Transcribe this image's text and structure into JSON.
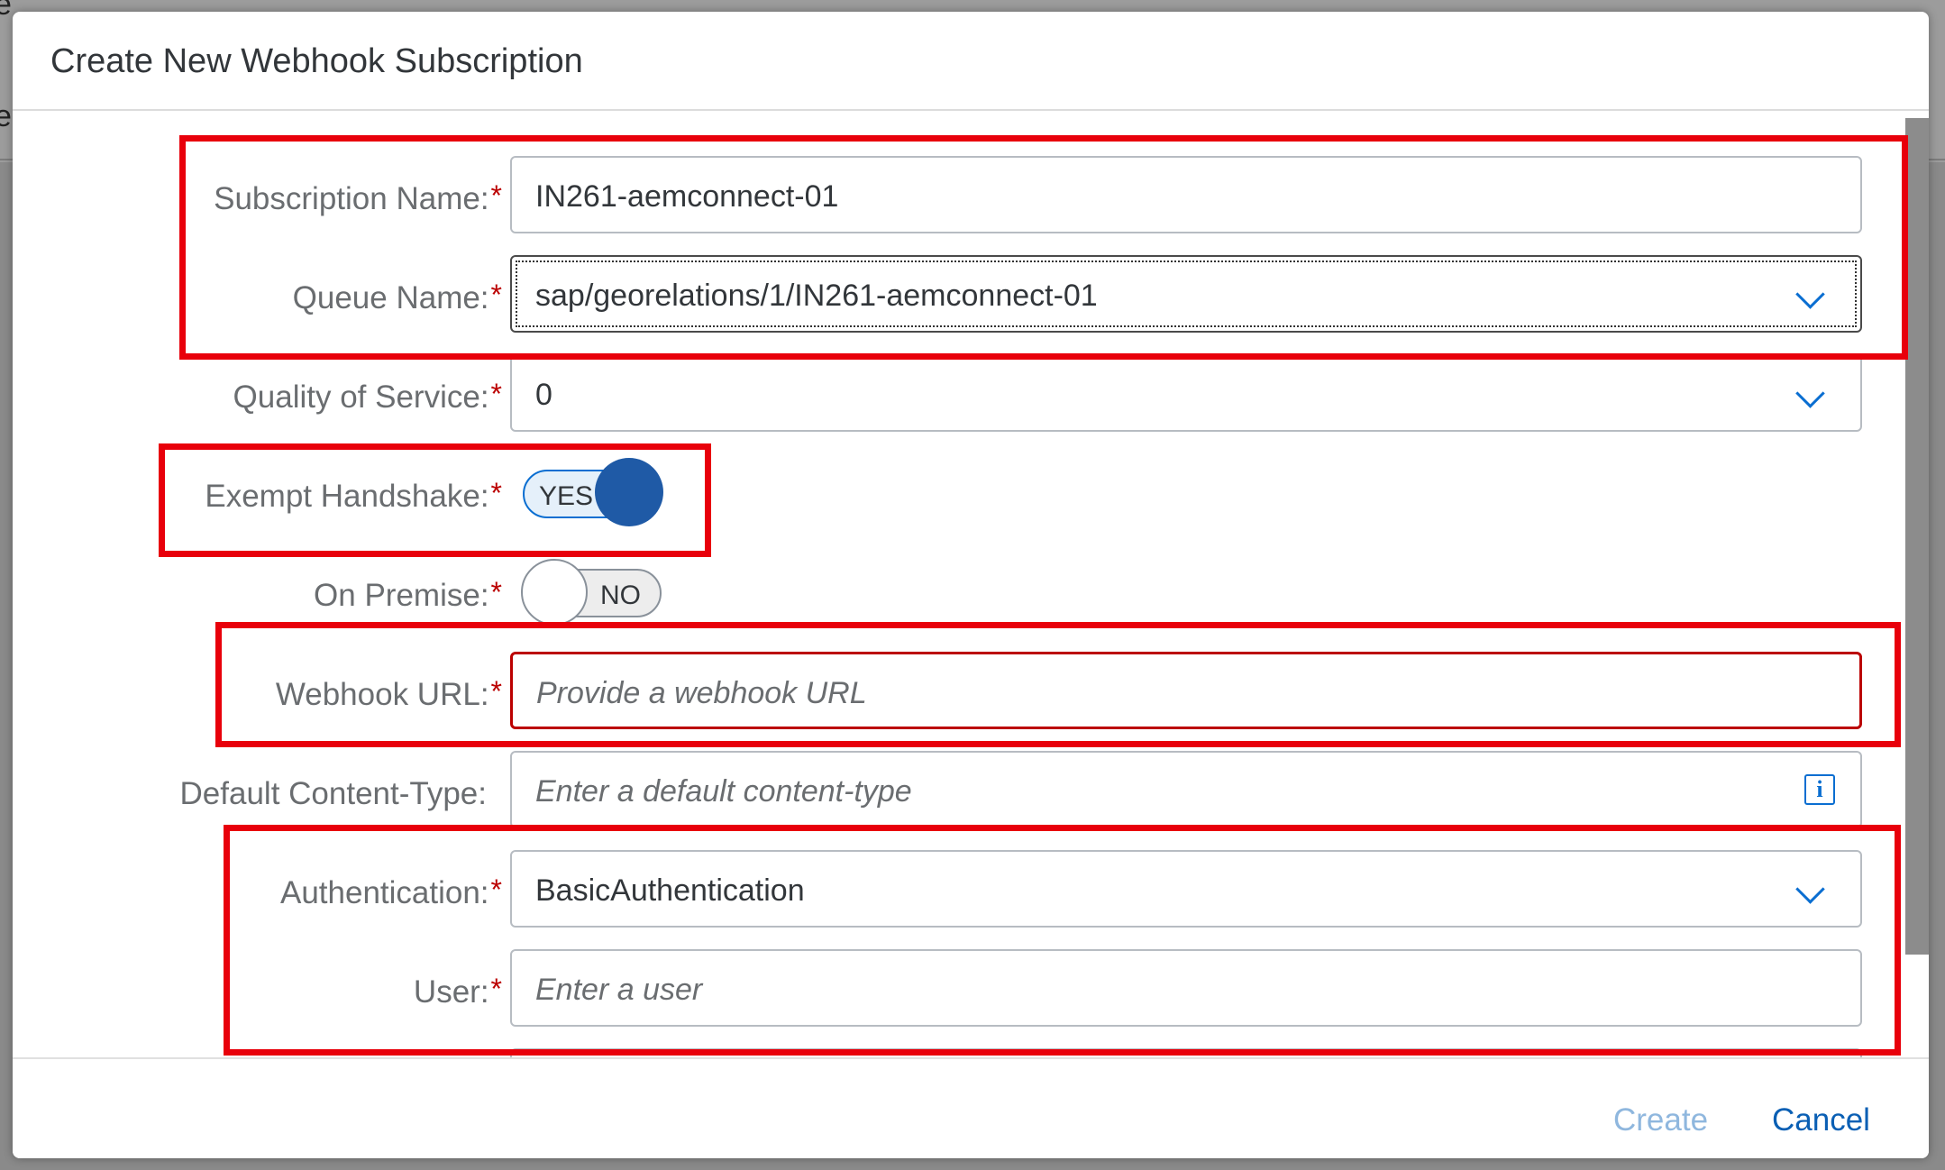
{
  "background": {
    "text_top": "e",
    "text_mid": "e"
  },
  "dialog": {
    "title": "Create New Webhook Subscription"
  },
  "form": {
    "subscription_name": {
      "label": "Subscription Name:",
      "required": "*",
      "value": "IN261-aemconnect-01"
    },
    "queue_name": {
      "label": "Queue Name:",
      "required": "*",
      "value": "sap/georelations/1/IN261-aemconnect-01"
    },
    "quality_of_service": {
      "label": "Quality of Service:",
      "required": "*",
      "value": "0"
    },
    "exempt_handshake": {
      "label": "Exempt Handshake:",
      "required": "*",
      "state": "YES"
    },
    "on_premise": {
      "label": "On Premise:",
      "required": "*",
      "state": "NO"
    },
    "webhook_url": {
      "label": "Webhook URL:",
      "required": "*",
      "placeholder": "Provide a webhook URL"
    },
    "default_content_type": {
      "label": "Default Content-Type:",
      "placeholder": "Enter a default content-type",
      "icon": "info-icon"
    },
    "authentication": {
      "label": "Authentication:",
      "required": "*",
      "value": "BasicAuthentication"
    },
    "user": {
      "label": "User:",
      "required": "*",
      "placeholder": "Enter a user"
    }
  },
  "footer": {
    "create_label": "Create",
    "cancel_label": "Cancel"
  },
  "colors": {
    "annotation": "#e8000b",
    "accent": "#0a6ed1",
    "required": "#bb0000"
  }
}
